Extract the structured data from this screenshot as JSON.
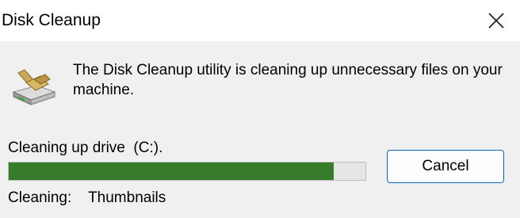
{
  "window": {
    "title": "Disk Cleanup"
  },
  "icons": {
    "app": "disk-cleanup-broom-drive-icon",
    "close": "close-icon"
  },
  "message": "The Disk Cleanup utility is cleaning up unnecessary files on your machine.",
  "progress": {
    "label": "Cleaning up drive  (C:).",
    "fraction": 0.91,
    "fill_color": "#367c2b"
  },
  "status": {
    "prefix": "Cleaning:",
    "item": "Thumbnails"
  },
  "buttons": {
    "cancel_label": "Cancel"
  },
  "colors": {
    "accent": "#0067c0",
    "progress": "#367c2b"
  }
}
